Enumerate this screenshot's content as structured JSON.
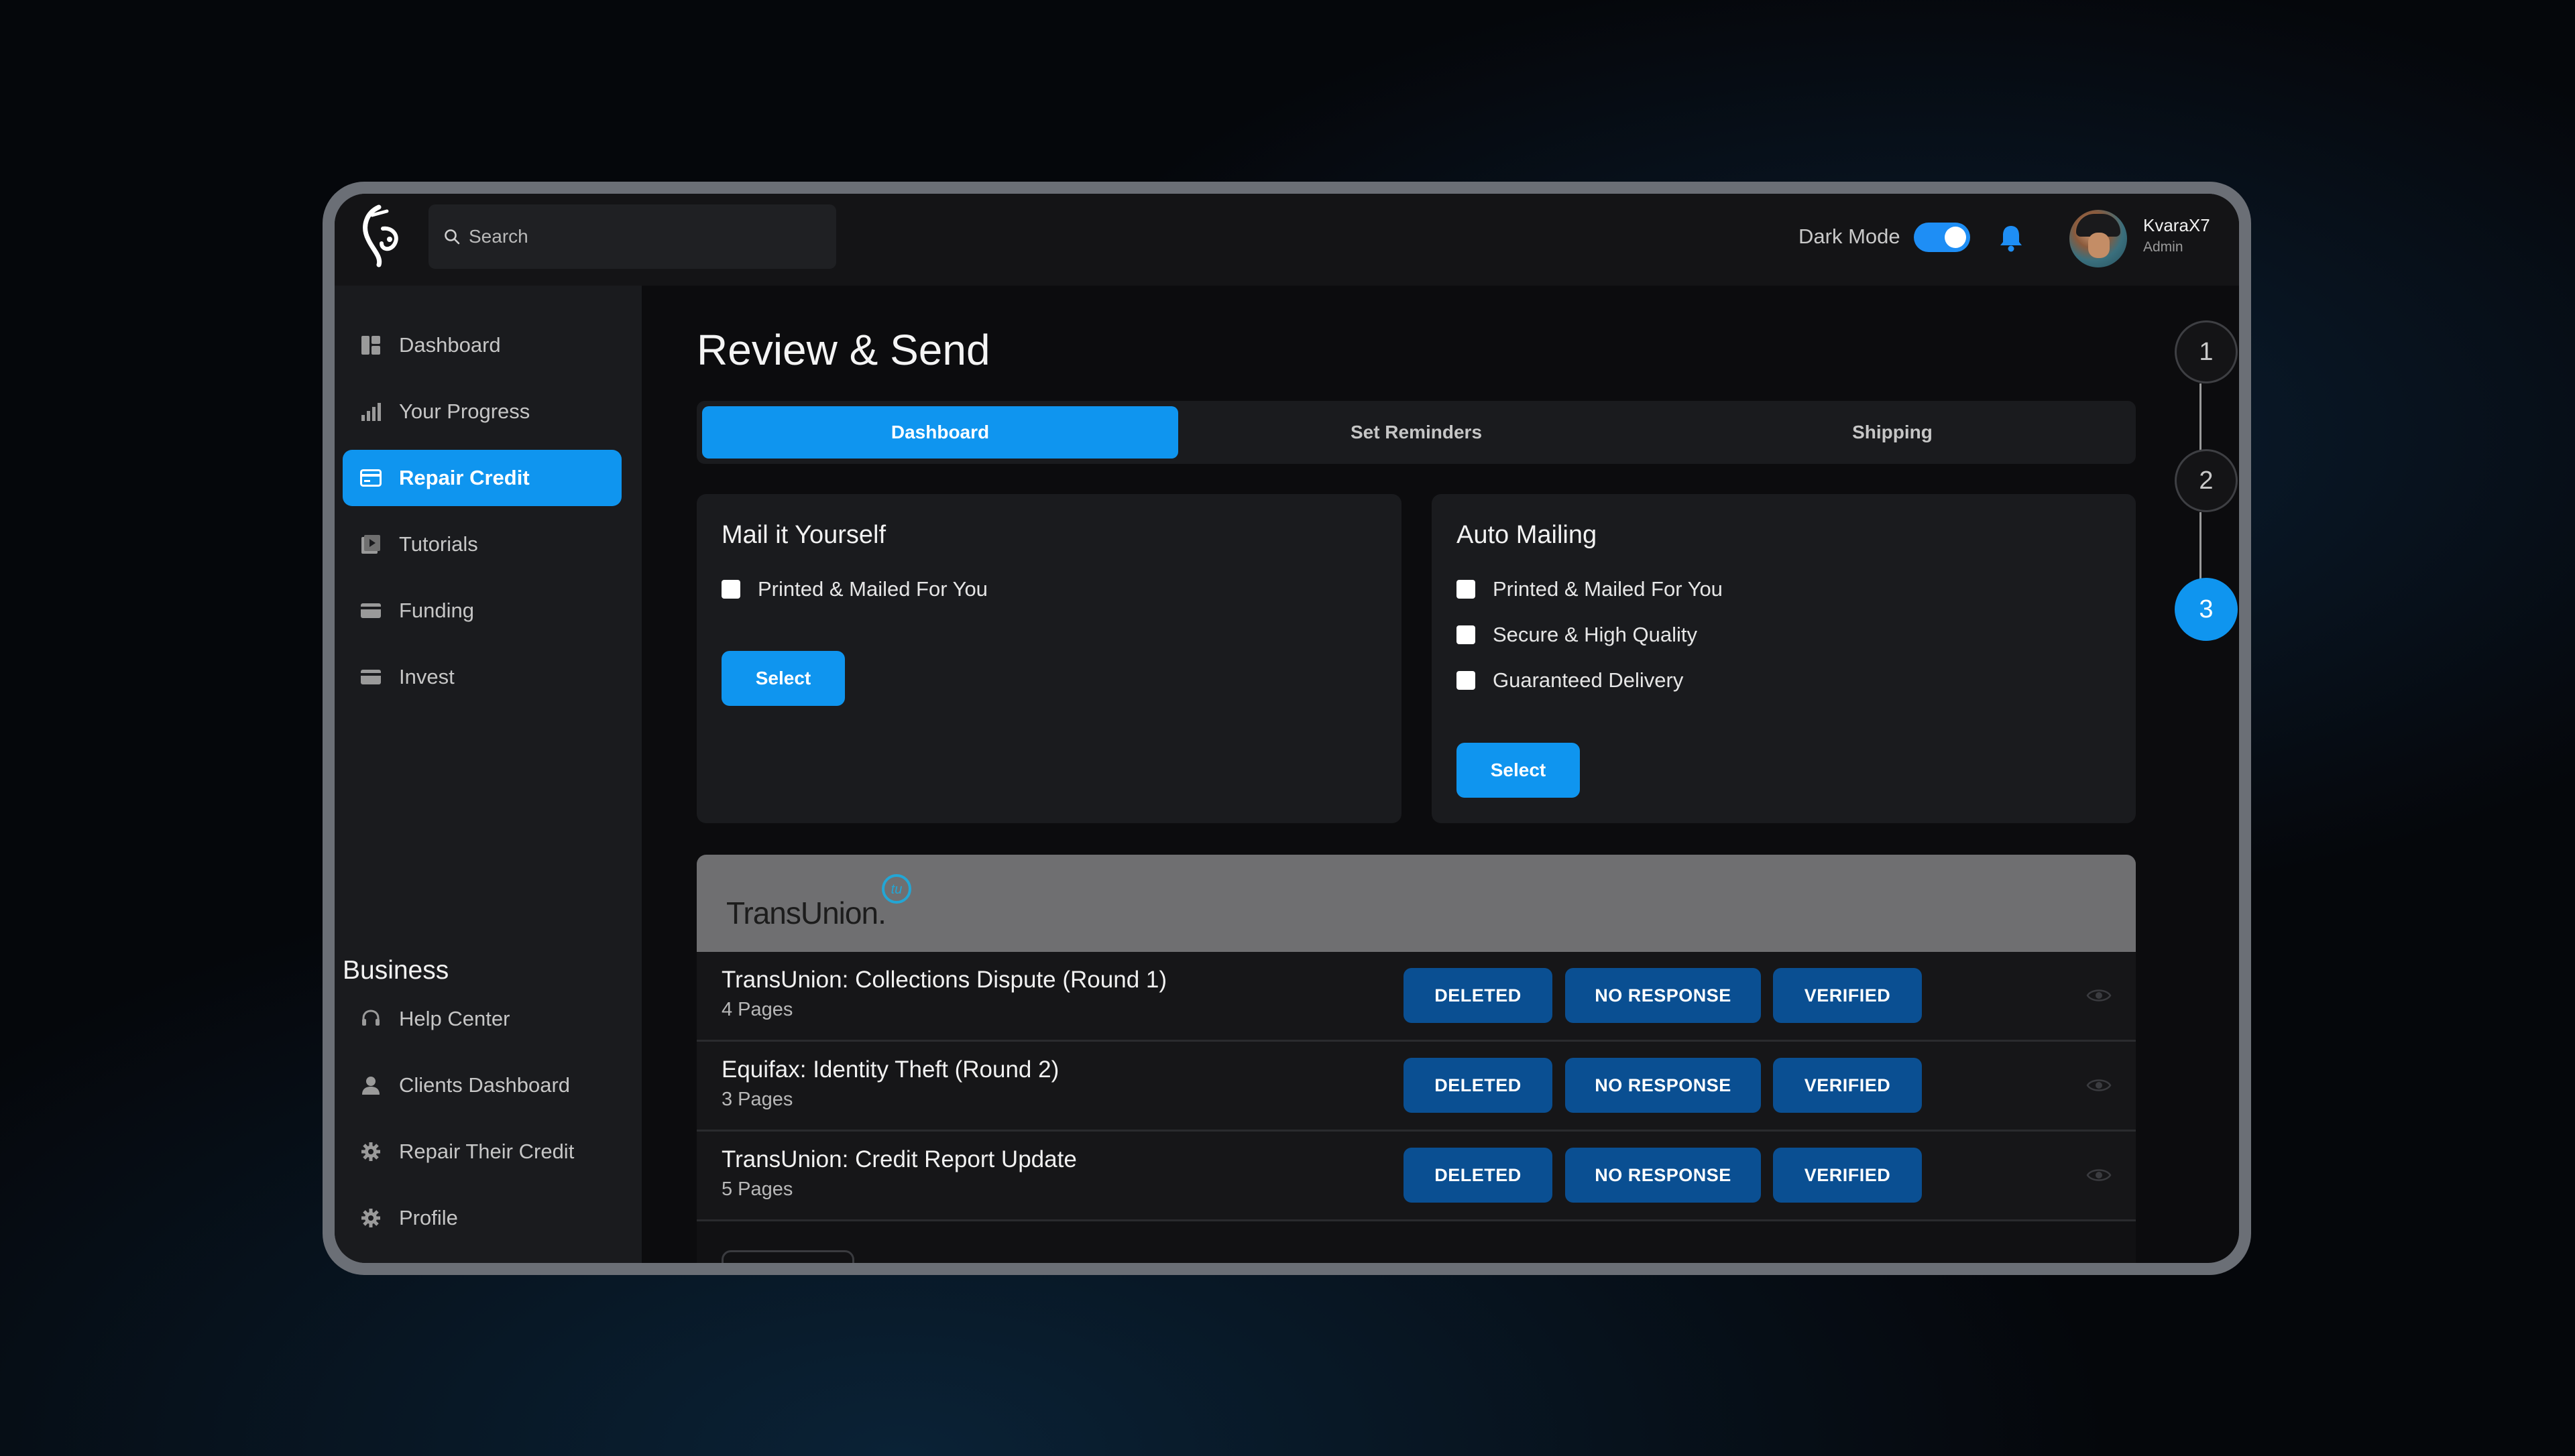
{
  "topbar": {
    "search_placeholder": "Search",
    "dark_mode_label": "Dark Mode",
    "dark_mode_on": true,
    "user_name": "KvaraX7",
    "user_role": "Admin"
  },
  "sidebar": {
    "items": [
      {
        "label": "Dashboard",
        "icon": "dashboard-icon",
        "active": false
      },
      {
        "label": "Your Progress",
        "icon": "bar-chart-icon",
        "active": false
      },
      {
        "label": "Repair Credit",
        "icon": "credit-card-icon",
        "active": true
      },
      {
        "label": "Tutorials",
        "icon": "video-icon",
        "active": false
      },
      {
        "label": "Funding",
        "icon": "card-icon",
        "active": false
      },
      {
        "label": "Invest",
        "icon": "card-icon",
        "active": false
      }
    ],
    "business_title": "Business",
    "business_items": [
      {
        "label": "Help Center",
        "icon": "headset-icon"
      },
      {
        "label": "Clients Dashboard",
        "icon": "person-icon"
      },
      {
        "label": "Repair Their Credit",
        "icon": "gear-icon"
      },
      {
        "label": "Profile",
        "icon": "gear-icon"
      }
    ]
  },
  "main": {
    "title": "Review & Send",
    "tabs": [
      {
        "label": "Dashboard",
        "active": true
      },
      {
        "label": "Set Reminders",
        "active": false
      },
      {
        "label": "Shipping",
        "active": false
      }
    ],
    "mail_card": {
      "title": "Mail it Yourself",
      "options": [
        "Printed & Mailed For You"
      ],
      "button": "Select"
    },
    "auto_card": {
      "title": "Auto Mailing",
      "options": [
        "Printed & Mailed For You",
        "Secure & High Quality",
        "Guaranteed Delivery"
      ],
      "button": "Select"
    },
    "bureau_logo": "TransUnion.",
    "bureau_badge": "tu",
    "letters": [
      {
        "title": "TransUnion: Collections Dispute (Round 1)",
        "pages": "4 Pages"
      },
      {
        "title": "Equifax: Identity Theft (Round 2)",
        "pages": "3 Pages"
      },
      {
        "title": "TransUnion: Credit Report Update",
        "pages": "5 Pages"
      }
    ],
    "status_buttons": {
      "deleted": "DELETED",
      "no_response": "NO RESPONSE",
      "verified": "VERIFIED"
    }
  },
  "stepper": {
    "steps": [
      "1",
      "2",
      "3"
    ],
    "active_step": 3
  },
  "colors": {
    "accent": "#0f95ef",
    "status_button": "#0a4f92",
    "sidebar_bg": "#1a1b1e"
  }
}
